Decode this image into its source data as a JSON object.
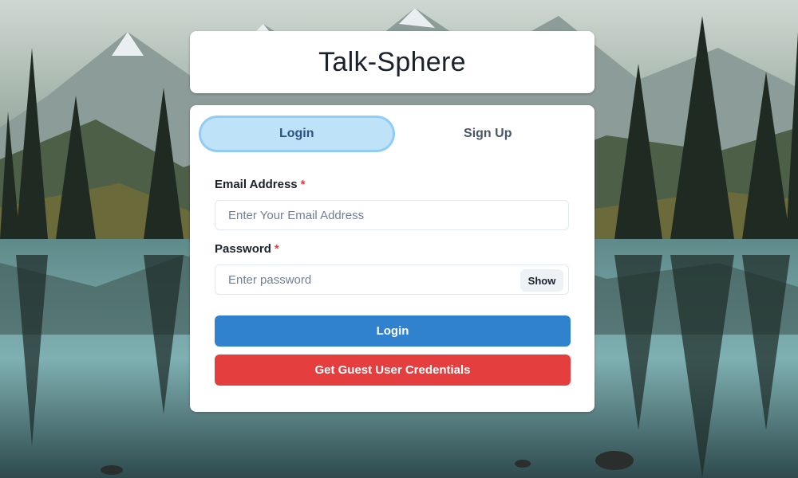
{
  "app": {
    "title": "Talk-Sphere"
  },
  "tabs": [
    {
      "label": "Login",
      "active": true
    },
    {
      "label": "Sign Up",
      "active": false
    }
  ],
  "form": {
    "email": {
      "label": "Email Address",
      "required_mark": "*",
      "placeholder": "Enter Your Email Address",
      "value": ""
    },
    "password": {
      "label": "Password",
      "required_mark": "*",
      "placeholder": "Enter password",
      "value": "",
      "toggle_label": "Show"
    },
    "login_button": "Login",
    "guest_button": "Get Guest User Credentials"
  },
  "colors": {
    "tab_active_bg": "#bee3f8",
    "tab_active_ring": "#90cdf4",
    "primary": "#3182ce",
    "danger": "#e53e3e",
    "required": "#e53e3e"
  },
  "background": {
    "icon": "mountain-lake-landscape"
  }
}
